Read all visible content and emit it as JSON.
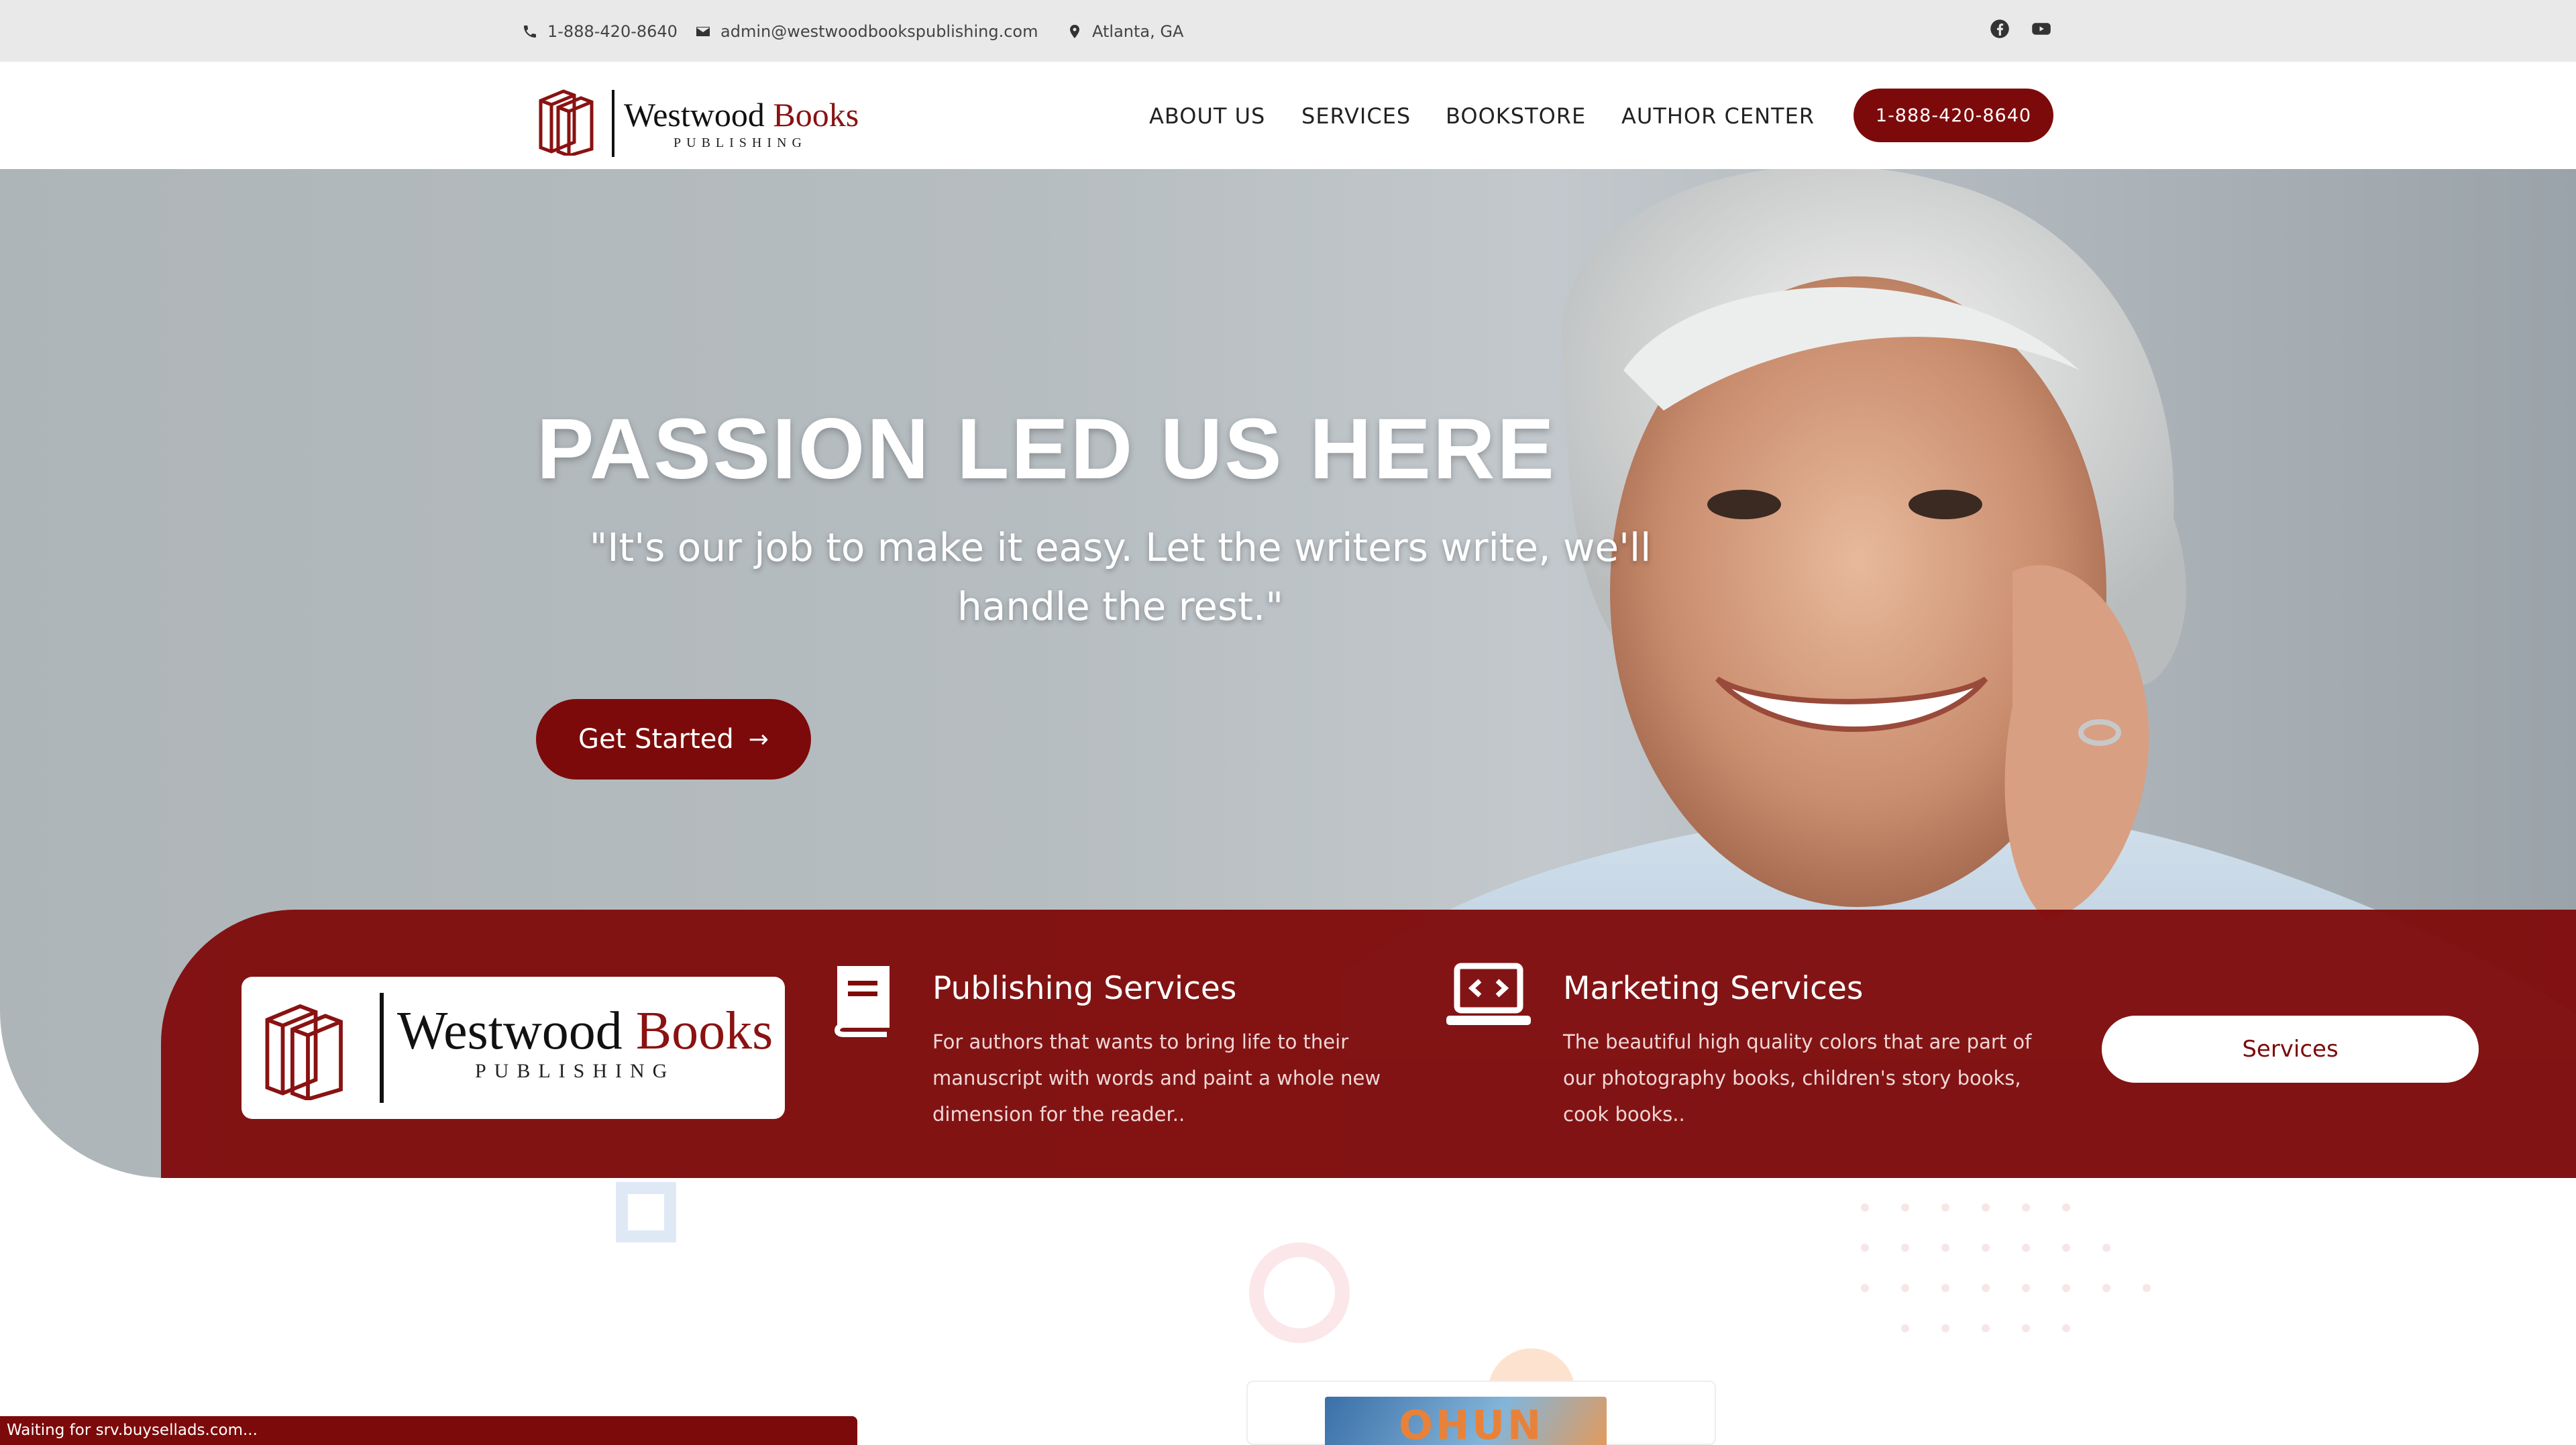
{
  "topbar": {
    "phone": "1-888-420-8640",
    "email": "admin@westwoodbookspublishing.com",
    "location": "Atlanta, GA",
    "social": [
      "facebook-icon",
      "youtube-icon"
    ]
  },
  "header": {
    "logo": {
      "main": "Westwood",
      "accent": "Books",
      "sub": "PUBLISHING"
    },
    "nav": [
      "ABOUT US",
      "SERVICES",
      "BOOKSTORE",
      "AUTHOR CENTER"
    ],
    "phone_button": "1-888-420-8640"
  },
  "hero": {
    "title": "PASSION LED US HERE",
    "quote": "\"It's our job to make it easy. Let the writers write, we'll handle the rest.\"",
    "cta_label": "Get Started",
    "cta_arrow": "→"
  },
  "band": {
    "logo": {
      "main": "Westwood",
      "accent": "Books",
      "sub": "PUBLISHING"
    },
    "publishing": {
      "title": "Publishing Services",
      "desc": "For authors that wants to bring life to their manuscript with words and paint a whole new dimension for the reader.."
    },
    "marketing": {
      "title": "Marketing Services",
      "desc": "The beautiful high quality colors that are part of our photography books, children's story books, cook books.."
    },
    "services_button": "Services"
  },
  "below": {
    "book_cover_text": "OHUN"
  },
  "status_bar": "Waiting for srv.buysellads.com...",
  "colors": {
    "brand": "#7d0a0a",
    "band": "#800a0a",
    "topbar": "#e9e9e9"
  }
}
